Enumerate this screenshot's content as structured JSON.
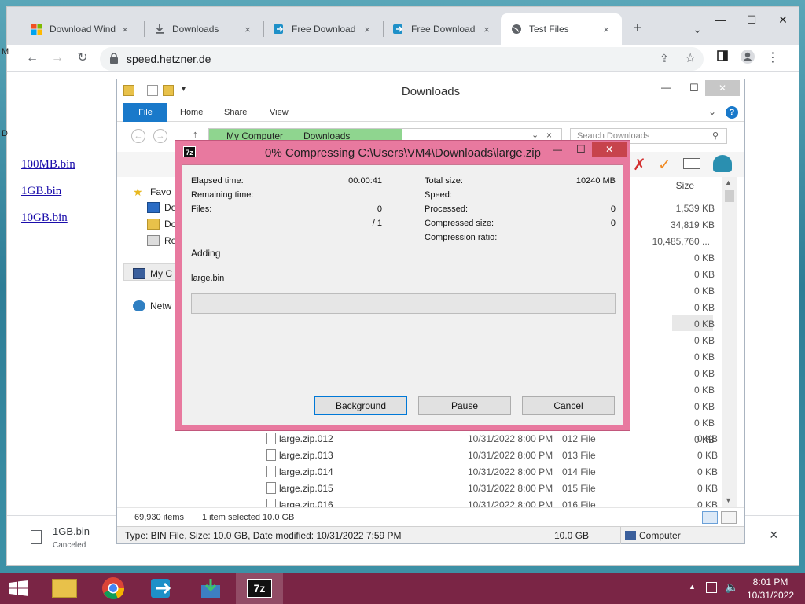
{
  "browser": {
    "tabs": [
      {
        "title": "Download Wind",
        "icon": "windows-logo-icon",
        "active": false
      },
      {
        "title": "Downloads",
        "icon": "download-icon",
        "active": false
      },
      {
        "title": "Free Download",
        "icon": "app-logo-icon",
        "active": false
      },
      {
        "title": "Free Download",
        "icon": "app-logo-icon",
        "active": false
      },
      {
        "title": "Test Files",
        "icon": "globe-icon",
        "active": true
      }
    ],
    "url": "speed.hetzner.de",
    "close_symbol": "×",
    "new_tab_symbol": "+",
    "window_controls": {
      "minimize": "—",
      "maximize": "☐",
      "close": "✕"
    }
  },
  "page": {
    "links": [
      "100MB.bin",
      "1GB.bin",
      "10GB.bin"
    ],
    "edge_letters": [
      "M",
      "D"
    ]
  },
  "download_shelf": {
    "filename": "1GB.bin",
    "status": "Canceled"
  },
  "explorer": {
    "title": "Downloads",
    "ribbon_tabs": [
      "File",
      "Home",
      "Share",
      "View"
    ],
    "breadcrumb": [
      "My Computer",
      "Downloads"
    ],
    "search_placeholder": "Search Downloads",
    "nav": [
      {
        "label": "Favo",
        "icon": "star-icon"
      },
      {
        "label": "De",
        "icon": "desktop-icon"
      },
      {
        "label": "Do",
        "icon": "folder-icon"
      },
      {
        "label": "Re",
        "icon": "recent-icon"
      },
      {
        "label": "My C",
        "icon": "computer-icon"
      },
      {
        "label": "Netw",
        "icon": "network-icon"
      }
    ],
    "size_header": "Size",
    "top_sizes": [
      "1,539 KB",
      "34,819 KB",
      "10,485,760 ...",
      "0 KB",
      "0 KB",
      "0 KB",
      "0 KB",
      "0 KB",
      "0 KB",
      "0 KB",
      "0 KB",
      "0 KB",
      "0 KB",
      "0 KB",
      "0 KB"
    ],
    "files": [
      {
        "name": "large.zip.012",
        "date": "10/31/2022 8:00 PM",
        "type": "012 File",
        "size": "0 KB"
      },
      {
        "name": "large.zip.013",
        "date": "10/31/2022 8:00 PM",
        "type": "013 File",
        "size": "0 KB"
      },
      {
        "name": "large.zip.014",
        "date": "10/31/2022 8:00 PM",
        "type": "014 File",
        "size": "0 KB"
      },
      {
        "name": "large.zip.015",
        "date": "10/31/2022 8:00 PM",
        "type": "015 File",
        "size": "0 KB"
      },
      {
        "name": "large.zip.016",
        "date": "10/31/2022 8:00 PM",
        "type": "016 File",
        "size": "0 KB"
      }
    ],
    "status": {
      "items": "69,930 items",
      "selected": "1 item selected  10.0 GB"
    },
    "details": {
      "text": "Type: BIN File, Size: 10.0 GB, Date modified: 10/31/2022 7:59 PM",
      "size": "10.0 GB",
      "location": "Computer"
    }
  },
  "sevenzip": {
    "icon_label": "7z",
    "title": "0% Compressing C:\\Users\\VM4\\Downloads\\large.zip",
    "left": [
      {
        "label": "Elapsed time:",
        "value": "00:00:41"
      },
      {
        "label": "Remaining time:",
        "value": ""
      },
      {
        "label": "Files:",
        "value": "0"
      },
      {
        "label": "",
        "value": "/ 1"
      }
    ],
    "right": [
      {
        "label": "Total size:",
        "value": "10240 MB"
      },
      {
        "label": "Speed:",
        "value": ""
      },
      {
        "label": "Processed:",
        "value": "0"
      },
      {
        "label": "Compressed size:",
        "value": "0"
      },
      {
        "label": "Compression ratio:",
        "value": ""
      }
    ],
    "action": "Adding",
    "current_file": "large.bin",
    "progress": 0,
    "buttons": {
      "background": "Background",
      "pause": "Pause",
      "cancel": "Cancel"
    }
  },
  "taskbar": {
    "apps": [
      {
        "name": "file-explorer-icon",
        "active": false
      },
      {
        "name": "chrome-icon",
        "active": false
      },
      {
        "name": "app-logo-icon",
        "active": false
      },
      {
        "name": "installer-icon",
        "active": false
      },
      {
        "name": "7zip-icon",
        "active": true,
        "label": "7z"
      }
    ],
    "time": "8:01 PM",
    "date": "10/31/2022"
  }
}
